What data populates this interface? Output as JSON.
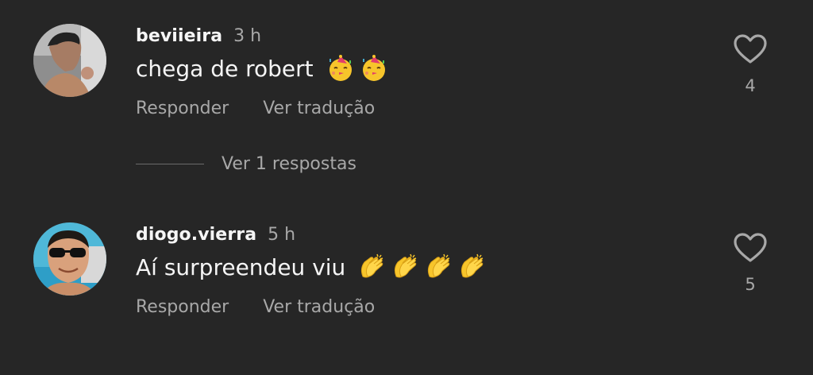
{
  "comments": [
    {
      "username": "beviieira",
      "time": "3 h",
      "text": "chega de robert",
      "emojis": [
        "partying-face-emoji",
        "partying-face-emoji"
      ],
      "reply_label": "Responder",
      "translate_label": "Ver tradução",
      "likes": "4"
    },
    {
      "username": "diogo.vierra",
      "time": "5 h",
      "text": "Aí surpreendeu viu",
      "emojis": [
        "clapping-hands-emoji",
        "clapping-hands-emoji",
        "clapping-hands-emoji",
        "clapping-hands-emoji"
      ],
      "reply_label": "Responder",
      "translate_label": "Ver tradução",
      "likes": "5"
    }
  ],
  "view_replies": {
    "label": "Ver 1 respostas"
  },
  "colors": {
    "background": "#262626",
    "primary_text": "#f5f5f5",
    "secondary_text": "#a8a8a8",
    "emoji_yellow": "#f7c52b"
  }
}
